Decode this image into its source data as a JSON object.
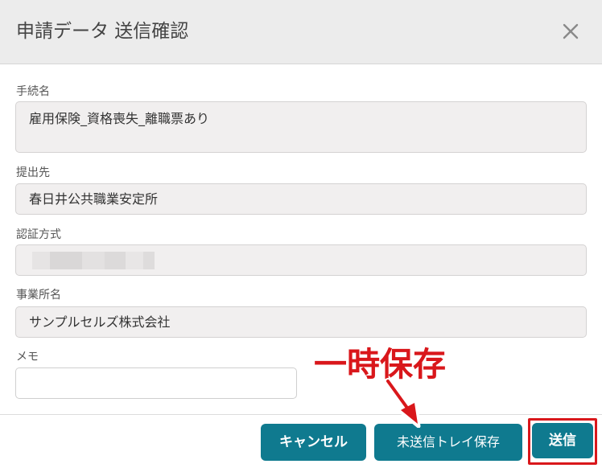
{
  "dialog": {
    "title": "申請データ 送信確認",
    "close_icon": "close-icon"
  },
  "fields": {
    "procedure": {
      "label": "手続名",
      "value": "雇用保険_資格喪失_離職票あり"
    },
    "destination": {
      "label": "提出先",
      "value": "春日井公共職業安定所"
    },
    "auth_method": {
      "label": "認証方式",
      "value_masked": true
    },
    "office": {
      "label": "事業所名",
      "value": "サンプルセルズ株式会社"
    },
    "memo": {
      "label": "メモ",
      "value": "",
      "placeholder": ""
    }
  },
  "buttons": {
    "cancel": "キャンセル",
    "save_to_tray": "未送信トレイ保存",
    "send": "送信"
  },
  "annotation": {
    "text": "一時保存",
    "color": "#d9171b"
  },
  "colors": {
    "accent": "#0f7a8f",
    "highlight": "#d9171b",
    "header_bg": "#ececec",
    "field_bg": "#f1efef"
  }
}
